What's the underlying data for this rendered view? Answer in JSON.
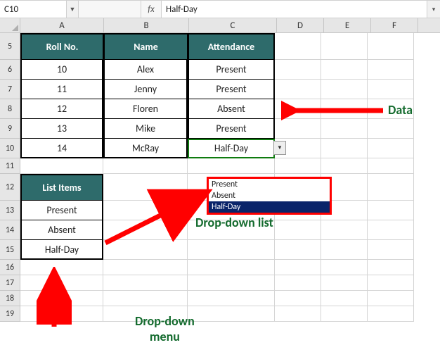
{
  "namebox": {
    "cellref": "C10"
  },
  "formulabar": {
    "fx": "fx",
    "value": "Half-Day"
  },
  "columns": [
    "A",
    "B",
    "C",
    "D",
    "E",
    "F"
  ],
  "rowheaders": [
    "5",
    "6",
    "7",
    "8",
    "9",
    "10",
    "11",
    "12",
    "13",
    "14",
    "15",
    "16",
    "17",
    "18",
    "19"
  ],
  "table": {
    "headers": {
      "roll": "Roll No.",
      "name": "Name",
      "attendance": "Attendance"
    },
    "rows": [
      {
        "roll": "10",
        "name": "Alex",
        "attendance": "Present"
      },
      {
        "roll": "11",
        "name": "Jenny",
        "attendance": "Present"
      },
      {
        "roll": "12",
        "name": "Floren",
        "attendance": "Absent"
      },
      {
        "roll": "13",
        "name": "Mike",
        "attendance": "Present"
      },
      {
        "roll": "14",
        "name": "McRay",
        "attendance": "Half-Day"
      }
    ]
  },
  "listbox": {
    "header": "List Items",
    "items": [
      "Present",
      "Absent",
      "Half-Day"
    ]
  },
  "dropdown": {
    "options": [
      "Present",
      "Absent",
      "Half-Day"
    ],
    "selected": "Half-Day"
  },
  "annotations": {
    "data": "Data",
    "ddlist": "Drop-down list",
    "ddmenu": "Drop-down\nmenu"
  }
}
